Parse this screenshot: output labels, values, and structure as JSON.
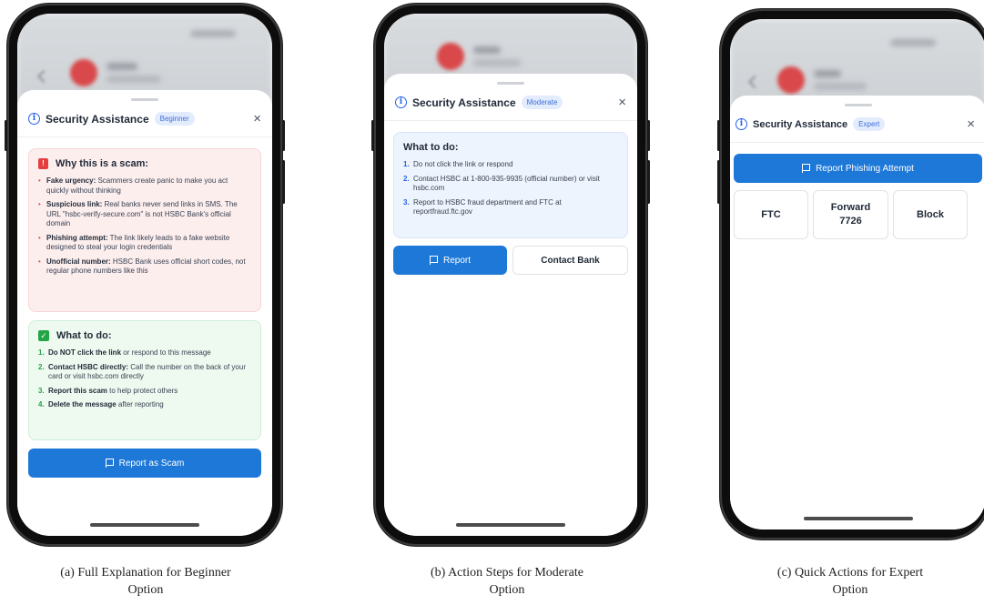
{
  "shared": {
    "sheet_title": "Security Assistance",
    "close_glyph": "×",
    "info_glyph": "i"
  },
  "phone_a": {
    "level": "Beginner",
    "why_title": "Why this is a scam:",
    "reasons": [
      {
        "bold": "Fake urgency:",
        "text": " Scammers create panic to make you act quickly without thinking"
      },
      {
        "bold": "Suspicious link:",
        "text": " Real banks never send links in SMS. The URL \"hsbc-verify-secure.com\" is not HSBC Bank's official domain"
      },
      {
        "bold": "Phishing attempt:",
        "text": " The link likely leads to a fake website designed to steal your login credentials"
      },
      {
        "bold": "Unofficial number:",
        "text": " HSBC Bank uses official short codes, not regular phone numbers like this"
      }
    ],
    "todo_title": "What to do:",
    "steps": [
      {
        "num": "1.",
        "bold": "Do NOT click the link",
        "text": " or respond to this message"
      },
      {
        "num": "2.",
        "bold": "Contact HSBC directly:",
        "text": " Call the number on the back of your card or visit hsbc.com directly"
      },
      {
        "num": "3.",
        "bold": "Report this scam",
        "text": " to help protect others"
      },
      {
        "num": "4.",
        "bold": "Delete the message",
        "text": " after reporting"
      }
    ],
    "report_button": "Report as Scam",
    "caption": "(a) Full Explanation for Beginner Option"
  },
  "phone_b": {
    "level": "Moderate",
    "todo_title": "What to do:",
    "steps": [
      {
        "num": "1.",
        "text": "Do not click the link or respond"
      },
      {
        "num": "2.",
        "text": "Contact HSBC at 1-800-935-9935 (official number) or visit hsbc.com"
      },
      {
        "num": "3.",
        "text": "Report to HSBC fraud department and FTC at reportfraud.ftc.gov"
      }
    ],
    "report_button": "Report",
    "contact_button": "Contact Bank",
    "caption": "(b) Action Steps for Moderate Option"
  },
  "phone_c": {
    "level": "Expert",
    "report_button": "Report Phishing Attempt",
    "tiles": [
      "FTC",
      "Forward 7726",
      "Block"
    ],
    "caption": "(c) Quick Actions for Expert Option"
  }
}
